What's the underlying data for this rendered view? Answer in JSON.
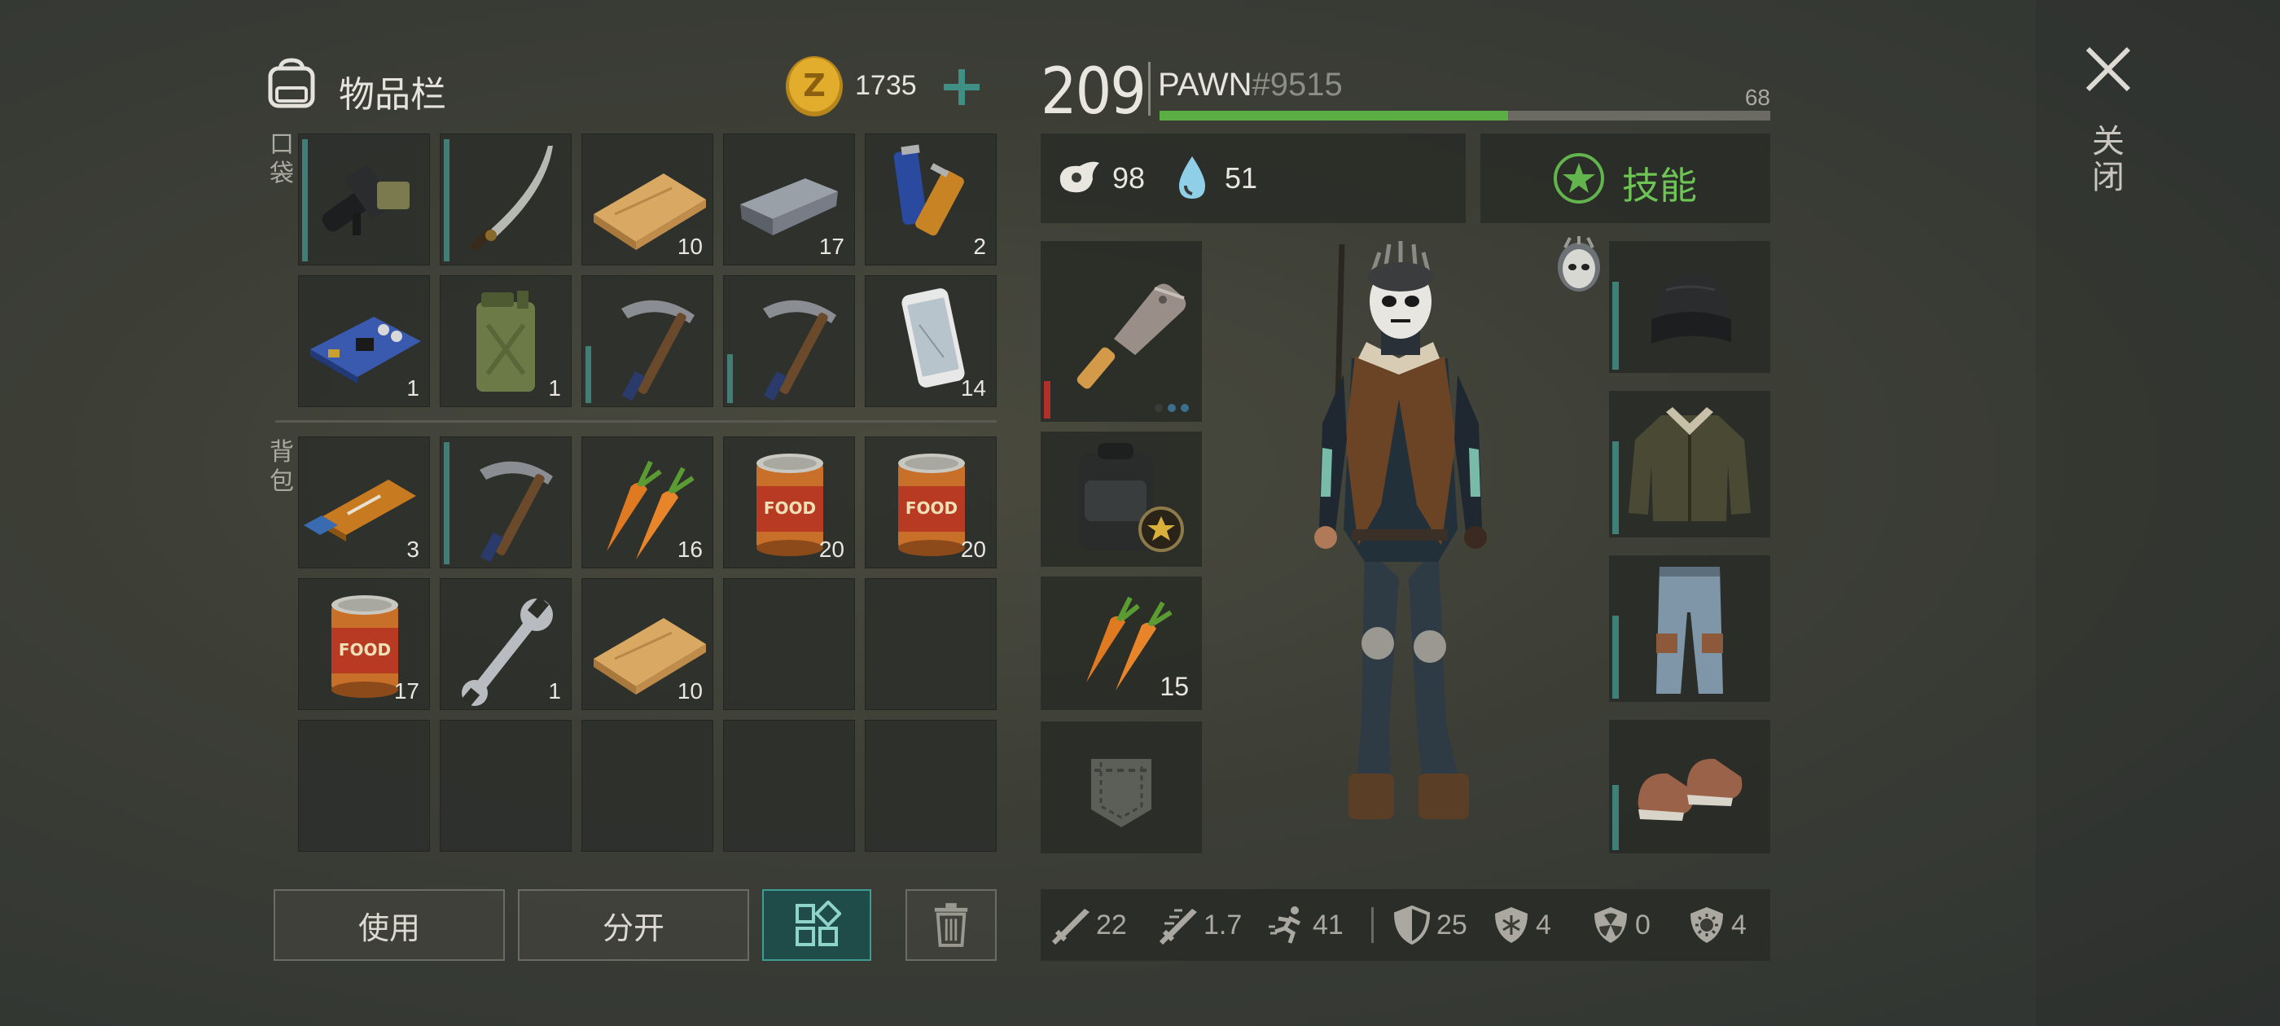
{
  "inventory": {
    "title": "物品栏",
    "coins": "1735",
    "pocket_label": "口袋",
    "backpack_label": "背包",
    "pocket": [
      {
        "icon": "flamethrower-icon",
        "count": ""
      },
      {
        "icon": "katana-icon",
        "count": ""
      },
      {
        "icon": "wood-plank-icon",
        "count": "10"
      },
      {
        "icon": "iron-bar-icon",
        "count": "17"
      },
      {
        "icon": "battery-icon",
        "count": "2"
      },
      {
        "icon": "circuit-board-icon",
        "count": "1"
      },
      {
        "icon": "jerrycan-icon",
        "count": "1"
      },
      {
        "icon": "pickaxe-icon",
        "count": ""
      },
      {
        "icon": "pickaxe-icon",
        "count": ""
      },
      {
        "icon": "smartphone-icon",
        "count": "14"
      }
    ],
    "backpack": [
      {
        "icon": "usb-drive-icon",
        "count": "3"
      },
      {
        "icon": "pickaxe-icon",
        "count": ""
      },
      {
        "icon": "carrot-icon",
        "count": "16"
      },
      {
        "icon": "canned-food-icon",
        "count": "20"
      },
      {
        "icon": "canned-food-icon",
        "count": "20"
      },
      {
        "icon": "canned-food-icon",
        "count": "17"
      },
      {
        "icon": "wrench-icon",
        "count": "1"
      },
      {
        "icon": "wood-plank-icon",
        "count": "10"
      },
      {
        "icon": "",
        "count": ""
      },
      {
        "icon": "",
        "count": ""
      },
      {
        "icon": "",
        "count": ""
      },
      {
        "icon": "",
        "count": ""
      },
      {
        "icon": "",
        "count": ""
      },
      {
        "icon": "",
        "count": ""
      },
      {
        "icon": "",
        "count": ""
      }
    ],
    "buttons": {
      "use": "使用",
      "split": "分开"
    }
  },
  "character": {
    "level": "209",
    "name": "PAWN",
    "tag": "#9515",
    "xp_value": "68",
    "xp_progress": 0.57,
    "food": "98",
    "water": "51",
    "skills_label": "技能",
    "quick_slots": [
      {
        "icon": "cleaver-icon",
        "count": ""
      },
      {
        "icon": "backpack-icon",
        "count": ""
      },
      {
        "icon": "carrot-icon",
        "count": "15"
      },
      {
        "icon": "pocket-icon",
        "count": ""
      }
    ],
    "equipment": [
      "beanie-icon",
      "jacket-icon",
      "jeans-icon",
      "shoes-icon"
    ],
    "stats": {
      "damage": "22",
      "attack_speed": "1.7",
      "speed": "41",
      "armor": "25",
      "cold_resist": "4",
      "radiation_resist": "0",
      "infection_resist": "4"
    }
  },
  "close_label": "关闭",
  "colors": {
    "accent": "#5aa84a",
    "teal": "#3e7f78",
    "coin": "#d9a52a"
  }
}
